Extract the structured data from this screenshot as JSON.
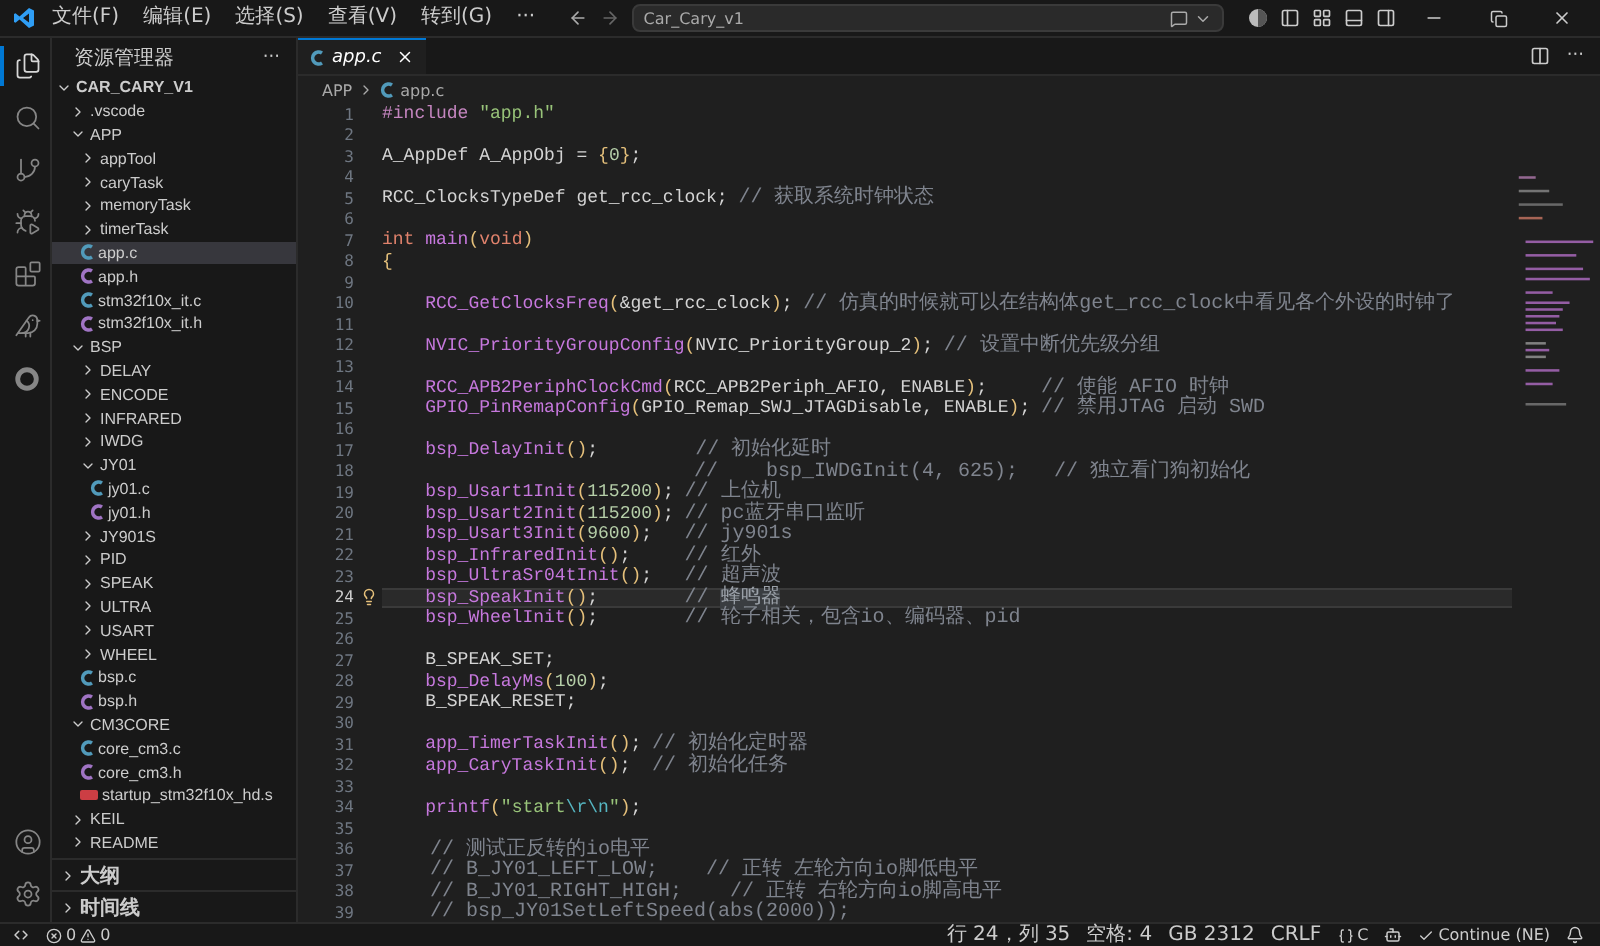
{
  "titlebar": {
    "menus": [
      "文件(F)",
      "编辑(E)",
      "选择(S)",
      "查看(V)",
      "转到(G)",
      "···"
    ],
    "search": {
      "value": "Car_Cary_v1"
    }
  },
  "activity": [
    {
      "kind": "files",
      "selected": true
    },
    {
      "kind": "search",
      "selected": false
    },
    {
      "kind": "git",
      "selected": false
    },
    {
      "kind": "debug",
      "selected": false
    },
    {
      "kind": "extensions",
      "selected": false
    },
    {
      "kind": "bird",
      "selected": false
    },
    {
      "kind": "ring",
      "selected": false
    }
  ],
  "explorer": {
    "title": "资源管理器",
    "more": "···",
    "root": {
      "label": "CAR_CARY_V1",
      "expanded": true,
      "children": [
        {
          "label": ".vscode",
          "kind": "folder",
          "expanded": false,
          "selected": false
        },
        {
          "label": "APP",
          "kind": "folder",
          "expanded": true,
          "selected": false,
          "children": [
            {
              "label": "appTool",
              "kind": "folder",
              "expanded": false,
              "selected": false
            },
            {
              "label": "caryTask",
              "kind": "folder",
              "expanded": false,
              "selected": false
            },
            {
              "label": "memoryTask",
              "kind": "folder",
              "expanded": false,
              "selected": false
            },
            {
              "label": "timerTask",
              "kind": "folder",
              "expanded": false,
              "selected": false
            },
            {
              "label": "app.c",
              "kind": "c",
              "selected": true
            },
            {
              "label": "app.h",
              "kind": "h",
              "selected": false
            },
            {
              "label": "stm32f10x_it.c",
              "kind": "c",
              "selected": false
            },
            {
              "label": "stm32f10x_it.h",
              "kind": "h",
              "selected": false
            }
          ]
        },
        {
          "label": "BSP",
          "kind": "folder",
          "expanded": true,
          "selected": false,
          "children": [
            {
              "label": "DELAY",
              "kind": "folder",
              "expanded": false,
              "selected": false
            },
            {
              "label": "ENCODE",
              "kind": "folder",
              "expanded": false,
              "selected": false
            },
            {
              "label": "INFRARED",
              "kind": "folder",
              "expanded": false,
              "selected": false
            },
            {
              "label": "IWDG",
              "kind": "folder",
              "expanded": false,
              "selected": false
            },
            {
              "label": "JY01",
              "kind": "folder",
              "expanded": true,
              "selected": false,
              "children": [
                {
                  "label": "jy01.c",
                  "kind": "c",
                  "selected": false
                },
                {
                  "label": "jy01.h",
                  "kind": "h",
                  "selected": false
                }
              ]
            },
            {
              "label": "JY901S",
              "kind": "folder",
              "expanded": false,
              "selected": false
            },
            {
              "label": "PID",
              "kind": "folder",
              "expanded": false,
              "selected": false
            },
            {
              "label": "SPEAK",
              "kind": "folder",
              "expanded": false,
              "selected": false
            },
            {
              "label": "ULTRA",
              "kind": "folder",
              "expanded": false,
              "selected": false
            },
            {
              "label": "USART",
              "kind": "folder",
              "expanded": false,
              "selected": false
            },
            {
              "label": "WHEEL",
              "kind": "folder",
              "expanded": false,
              "selected": false
            },
            {
              "label": "bsp.c",
              "kind": "c",
              "selected": false
            },
            {
              "label": "bsp.h",
              "kind": "h",
              "selected": false
            }
          ]
        },
        {
          "label": "CM3CORE",
          "kind": "folder",
          "expanded": true,
          "selected": false,
          "children": [
            {
              "label": "core_cm3.c",
              "kind": "c",
              "selected": false
            },
            {
              "label": "core_cm3.h",
              "kind": "h",
              "selected": false
            },
            {
              "label": "startup_stm32f10x_hd.s",
              "kind": "asm",
              "selected": false
            }
          ]
        },
        {
          "label": "KEIL",
          "kind": "folder",
          "expanded": false,
          "selected": false
        },
        {
          "label": "README",
          "kind": "folder",
          "expanded": false,
          "selected": false
        }
      ]
    }
  },
  "panels": [
    {
      "label": "大纲",
      "expanded": false
    },
    {
      "label": "时间线",
      "expanded": false
    }
  ],
  "tabs": [
    {
      "label": "app.c",
      "kind": "c",
      "selected": true
    }
  ],
  "editor_more": "···",
  "breadcrumb": [
    {
      "label": "APP",
      "kind": "folder"
    },
    {
      "label": "app.c",
      "kind": "c"
    }
  ],
  "code": {
    "lines": [
      {
        "n": "1",
        "current": false,
        "tokens": [
          {
            "text": "#include ",
            "kind": "pp"
          },
          {
            "text": "\"app.h\"",
            "kind": "str"
          }
        ]
      },
      {
        "n": "2",
        "current": false
      },
      {
        "n": "3",
        "current": false,
        "tokens": [
          {
            "text": "A_AppDef A_AppObj = ",
            "kind": "txt"
          },
          {
            "text": "{",
            "kind": "p"
          },
          {
            "text": "0",
            "kind": "num"
          },
          {
            "text": "}",
            "kind": "p"
          },
          {
            "text": ";",
            "kind": "txt"
          }
        ]
      },
      {
        "n": "4",
        "current": false
      },
      {
        "n": "5",
        "current": false,
        "tokens": [
          {
            "text": "RCC_ClocksTypeDef get_rcc_clock; ",
            "kind": "txt"
          },
          {
            "text": "// 获取系统时钟状态",
            "kind": "cmt"
          }
        ]
      },
      {
        "n": "6",
        "current": false
      },
      {
        "n": "7",
        "current": false,
        "tokens": [
          {
            "text": "int ",
            "kind": "kw"
          },
          {
            "text": "main",
            "kind": "fn"
          },
          {
            "text": "(",
            "kind": "p"
          },
          {
            "text": "void",
            "kind": "kw"
          },
          {
            "text": ")",
            "kind": "p"
          }
        ]
      },
      {
        "n": "8",
        "current": false,
        "tokens": [
          {
            "text": "{",
            "kind": "p"
          }
        ]
      },
      {
        "n": "9",
        "current": false
      },
      {
        "n": "10",
        "current": false,
        "tokens": [
          {
            "text": "    RCC_GetClocksFreq",
            "kind": "fn"
          },
          {
            "text": "(",
            "kind": "p"
          },
          {
            "text": "&get_rcc_clock",
            "kind": "txt"
          },
          {
            "text": ")",
            "kind": "p"
          },
          {
            "text": "; ",
            "kind": "txt"
          },
          {
            "text": "// 仿真的时候就可以在结构体get_rcc_clock中看见各个外设的时钟了",
            "kind": "cmt"
          }
        ]
      },
      {
        "n": "11",
        "current": false
      },
      {
        "n": "12",
        "current": false,
        "tokens": [
          {
            "text": "    NVIC_PriorityGroupConfig",
            "kind": "fn"
          },
          {
            "text": "(",
            "kind": "p"
          },
          {
            "text": "NVIC_PriorityGroup_2",
            "kind": "txt"
          },
          {
            "text": ")",
            "kind": "p"
          },
          {
            "text": "; ",
            "kind": "txt"
          },
          {
            "text": "// 设置中断优先级分组",
            "kind": "cmt"
          }
        ]
      },
      {
        "n": "13",
        "current": false
      },
      {
        "n": "14",
        "current": false,
        "tokens": [
          {
            "text": "    RCC_APB2PeriphClockCmd",
            "kind": "fn"
          },
          {
            "text": "(",
            "kind": "p"
          },
          {
            "text": "RCC_APB2Periph_AFIO, ENABLE",
            "kind": "txt"
          },
          {
            "text": ")",
            "kind": "p"
          },
          {
            "text": ";     ",
            "kind": "txt"
          },
          {
            "text": "// 使能 AFIO 时钟",
            "kind": "cmt"
          }
        ]
      },
      {
        "n": "15",
        "current": false,
        "tokens": [
          {
            "text": "    GPIO_PinRemapConfig",
            "kind": "fn"
          },
          {
            "text": "(",
            "kind": "p"
          },
          {
            "text": "GPIO_Remap_SWJ_JTAGDisable, ENABLE",
            "kind": "txt"
          },
          {
            "text": ")",
            "kind": "p"
          },
          {
            "text": "; ",
            "kind": "txt"
          },
          {
            "text": "// 禁用JTAG 启动 SWD",
            "kind": "cmt"
          }
        ]
      },
      {
        "n": "16",
        "current": false
      },
      {
        "n": "17",
        "current": false,
        "tokens": [
          {
            "text": "    bsp_DelayInit",
            "kind": "fn"
          },
          {
            "text": "()",
            "kind": "p"
          },
          {
            "text": ";         ",
            "kind": "txt"
          },
          {
            "text": "// 初始化延时",
            "kind": "cmt"
          }
        ]
      },
      {
        "n": "18",
        "current": false,
        "tokens": [
          {
            "text": "                          //    bsp_IWDGInit(4, 625);   // 独立看门狗初始化",
            "kind": "cmt"
          }
        ]
      },
      {
        "n": "19",
        "current": false,
        "tokens": [
          {
            "text": "    bsp_Usart1Init",
            "kind": "fn"
          },
          {
            "text": "(",
            "kind": "p"
          },
          {
            "text": "115200",
            "kind": "num"
          },
          {
            "text": ")",
            "kind": "p"
          },
          {
            "text": "; ",
            "kind": "txt"
          },
          {
            "text": "// 上位机",
            "kind": "cmt"
          }
        ]
      },
      {
        "n": "20",
        "current": false,
        "tokens": [
          {
            "text": "    bsp_Usart2Init",
            "kind": "fn"
          },
          {
            "text": "(",
            "kind": "p"
          },
          {
            "text": "115200",
            "kind": "num"
          },
          {
            "text": ")",
            "kind": "p"
          },
          {
            "text": "; ",
            "kind": "txt"
          },
          {
            "text": "// pc蓝牙串口监听",
            "kind": "cmt"
          }
        ]
      },
      {
        "n": "21",
        "current": false,
        "tokens": [
          {
            "text": "    bsp_Usart3Init",
            "kind": "fn"
          },
          {
            "text": "(",
            "kind": "p"
          },
          {
            "text": "9600",
            "kind": "num"
          },
          {
            "text": ")",
            "kind": "p"
          },
          {
            "text": ";   ",
            "kind": "txt"
          },
          {
            "text": "// jy901s",
            "kind": "cmt"
          }
        ]
      },
      {
        "n": "22",
        "current": false,
        "tokens": [
          {
            "text": "    bsp_InfraredInit",
            "kind": "fn"
          },
          {
            "text": "()",
            "kind": "p"
          },
          {
            "text": ";     ",
            "kind": "txt"
          },
          {
            "text": "// 红外",
            "kind": "cmt"
          }
        ]
      },
      {
        "n": "23",
        "current": false,
        "tokens": [
          {
            "text": "    bsp_UltraSr04tInit",
            "kind": "fn"
          },
          {
            "text": "()",
            "kind": "p"
          },
          {
            "text": ";   ",
            "kind": "txt"
          },
          {
            "text": "// 超声波",
            "kind": "cmt"
          }
        ]
      },
      {
        "n": "24",
        "current": true,
        "tokens": [
          {
            "text": "    bsp_SpeakInit",
            "kind": "fn"
          },
          {
            "text": "()",
            "kind": "p"
          },
          {
            "text": ";        ",
            "kind": "txt"
          },
          {
            "text": "// ",
            "kind": "cmt"
          },
          {
            "text": "蜂鸣器",
            "kind": "sel"
          }
        ]
      },
      {
        "n": "25",
        "current": false,
        "tokens": [
          {
            "text": "    bsp_WheelInit",
            "kind": "fn"
          },
          {
            "text": "()",
            "kind": "p"
          },
          {
            "text": ";        ",
            "kind": "txt"
          },
          {
            "text": "// 轮子相关，包含io、编码器、pid",
            "kind": "cmt"
          }
        ]
      },
      {
        "n": "26",
        "current": false
      },
      {
        "n": "27",
        "current": false,
        "tokens": [
          {
            "text": "    B_SPEAK_SET;",
            "kind": "txt"
          }
        ]
      },
      {
        "n": "28",
        "current": false,
        "tokens": [
          {
            "text": "    bsp_DelayMs",
            "kind": "fn"
          },
          {
            "text": "(",
            "kind": "p"
          },
          {
            "text": "100",
            "kind": "num"
          },
          {
            "text": ")",
            "kind": "p"
          },
          {
            "text": ";",
            "kind": "txt"
          }
        ]
      },
      {
        "n": "29",
        "current": false,
        "tokens": [
          {
            "text": "    B_SPEAK_RESET;",
            "kind": "txt"
          }
        ]
      },
      {
        "n": "30",
        "current": false
      },
      {
        "n": "31",
        "current": false,
        "tokens": [
          {
            "text": "    app_TimerTaskInit",
            "kind": "fn"
          },
          {
            "text": "()",
            "kind": "p"
          },
          {
            "text": "; ",
            "kind": "txt"
          },
          {
            "text": "// 初始化定时器",
            "kind": "cmt"
          }
        ]
      },
      {
        "n": "32",
        "current": false,
        "tokens": [
          {
            "text": "    app_CaryTaskInit",
            "kind": "fn"
          },
          {
            "text": "()",
            "kind": "p"
          },
          {
            "text": ";  ",
            "kind": "txt"
          },
          {
            "text": "// 初始化任务",
            "kind": "cmt"
          }
        ]
      },
      {
        "n": "33",
        "current": false
      },
      {
        "n": "34",
        "current": false,
        "tokens": [
          {
            "text": "    printf",
            "kind": "fn"
          },
          {
            "text": "(",
            "kind": "p"
          },
          {
            "text": "\"start",
            "kind": "str"
          },
          {
            "text": "\\r\\n",
            "kind": "esc"
          },
          {
            "text": "\"",
            "kind": "str"
          },
          {
            "text": ")",
            "kind": "p"
          },
          {
            "text": ";",
            "kind": "txt"
          }
        ]
      },
      {
        "n": "35",
        "current": false
      },
      {
        "n": "36",
        "current": false,
        "tokens": [
          {
            "text": "    // 测试正反转的io电平",
            "kind": "cmt"
          }
        ]
      },
      {
        "n": "37",
        "current": false,
        "tokens": [
          {
            "text": "    // B_JY01_LEFT_LOW;    // 正转 左轮方向io脚低电平",
            "kind": "cmt"
          }
        ]
      },
      {
        "n": "38",
        "current": false,
        "tokens": [
          {
            "text": "    // B_JY01_RIGHT_HIGH;    // 正转 右轮方向io脚高电平",
            "kind": "cmt"
          }
        ]
      },
      {
        "n": "39",
        "current": false,
        "tokens": [
          {
            "text": "    // bsp_JY01SetLeftSpeed(abs(2000));",
            "kind": "cmt"
          }
        ]
      }
    ]
  },
  "status": {
    "errors": "0",
    "warnings": "0",
    "right": [
      {
        "kind": "text",
        "label": "行 24，列 35"
      },
      {
        "kind": "text",
        "label": "空格: 4"
      },
      {
        "kind": "text",
        "label": "GB 2312"
      },
      {
        "kind": "text",
        "label": "CRLF"
      },
      {
        "kind": "language",
        "label": "C"
      },
      {
        "kind": "copilot"
      },
      {
        "kind": "check",
        "label": "Continue (NE)"
      },
      {
        "kind": "bell"
      }
    ]
  }
}
